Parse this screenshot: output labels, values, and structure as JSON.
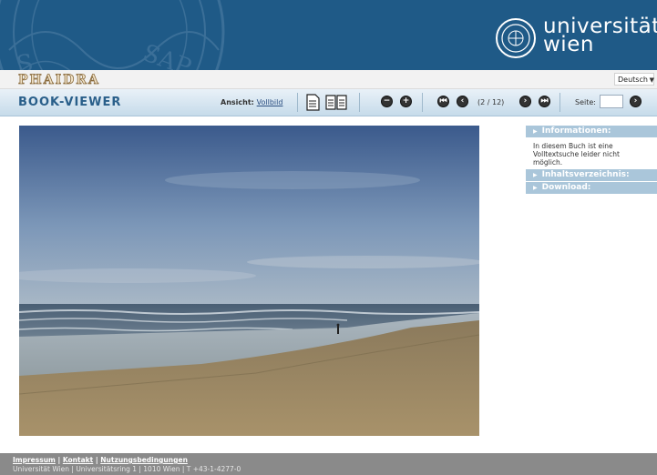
{
  "header": {
    "university_line1": "universität",
    "university_line2": "wien",
    "seal_text": "S SAP"
  },
  "phaidra": {
    "logo_text": "PHAIDRA",
    "language": "Deutsch"
  },
  "toolbar": {
    "app_name": "BOOK-VIEWER",
    "view_label": "Ansicht:",
    "view_value": "Vollbild",
    "page_count": "(2 / 12)",
    "page_label": "Seite:",
    "page_input_value": ""
  },
  "sidebar": {
    "info_header": "Informationen:",
    "info_text": "In diesem Buch ist eine Volltextsuche leider nicht möglich.",
    "toc_header": "Inhaltsverzeichnis:",
    "download_header": "Download:"
  },
  "footer": {
    "impressum": "Impressum",
    "kontakt": "Kontakt",
    "nutzung": "Nutzungsbedingungen",
    "separator": "|",
    "address": "Universität Wien | Universitätsring 1 | 1010 Wien | T +43-1-4277-0"
  },
  "colors": {
    "header_blue": "#1f5a87",
    "toolbar_light": "#e9f1f8",
    "sidebar_header": "#aac6da",
    "footer_gray": "#8a8a8a"
  }
}
